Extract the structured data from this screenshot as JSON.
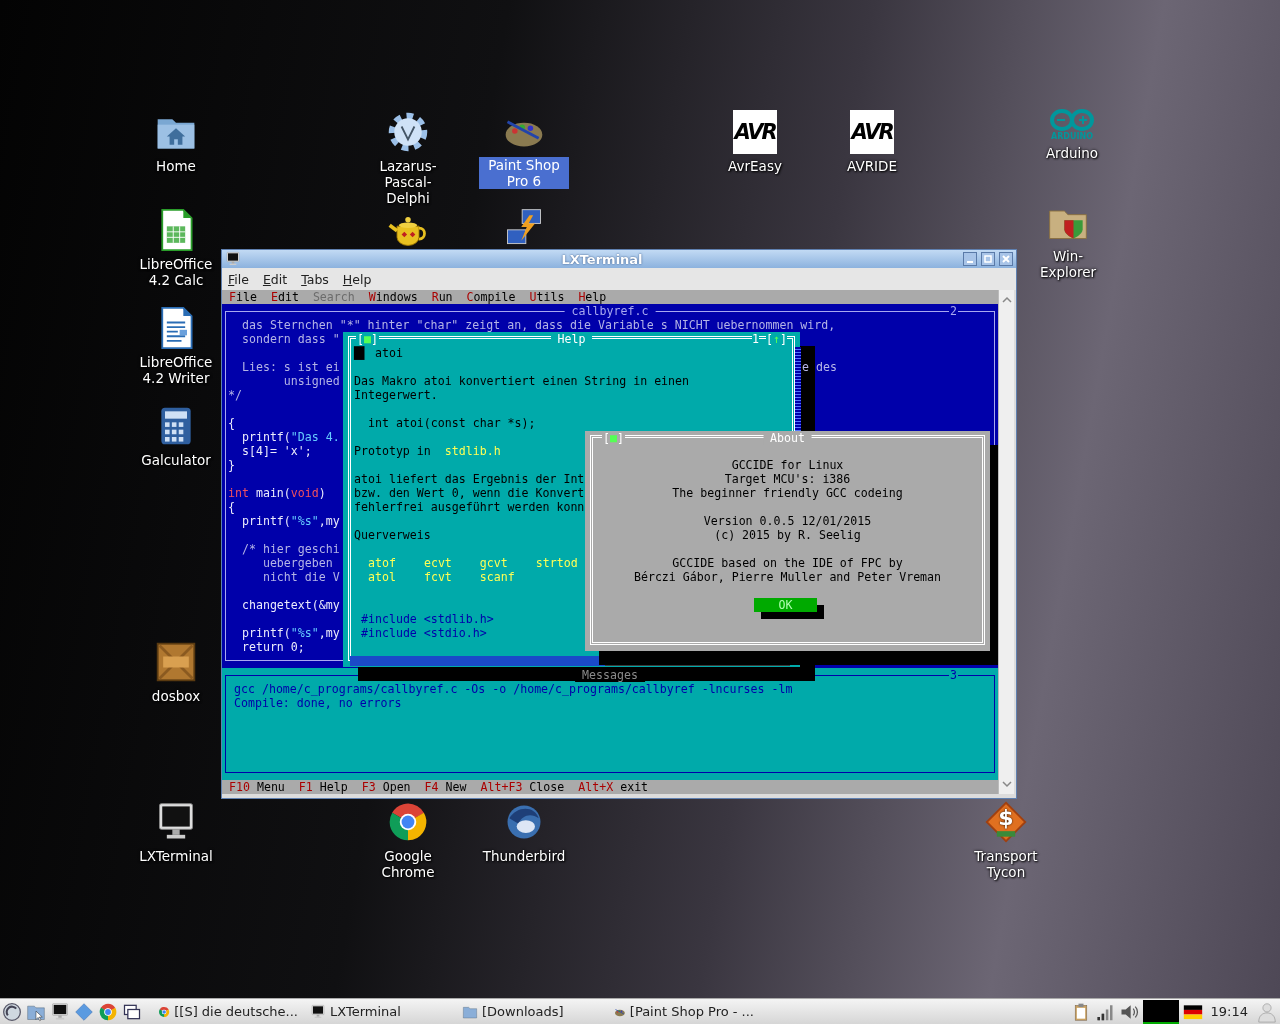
{
  "desktop_icons": [
    {
      "label": "Home",
      "kind": "home",
      "selected": false
    },
    {
      "label": "Lazarus-Pascal-Delphi",
      "kind": "gear",
      "selected": false
    },
    {
      "label": "Paint Shop Pro 6",
      "kind": "palette",
      "selected": true
    },
    {
      "label": "AvrEasy",
      "kind": "avr",
      "logo_text": "AVR",
      "selected": false
    },
    {
      "label": "AVRIDE",
      "kind": "avr",
      "logo_text": "AVR",
      "selected": false
    },
    {
      "label": "Arduino",
      "kind": "arduino",
      "logo_text": "ARDUINO",
      "selected": false
    },
    {
      "label": "LibreOffice 4.2 Calc",
      "kind": "spreadsheet",
      "selected": false
    },
    {
      "kind": "teapot",
      "selected": false
    },
    {
      "kind": "network",
      "selected": false
    },
    {
      "label": "Win-Explorer",
      "kind": "explorer",
      "selected": false
    },
    {
      "label": "LibreOffice 4.2 Writer",
      "kind": "document",
      "selected": false
    },
    {
      "label": "Galculator",
      "kind": "calculator",
      "selected": false
    },
    {
      "label": "dosbox",
      "kind": "dosbox",
      "selected": false
    },
    {
      "label": "LXTerminal",
      "kind": "monitor",
      "selected": false
    },
    {
      "label": "Google Chrome",
      "kind": "chrome",
      "selected": false
    },
    {
      "label": "Thunderbird",
      "kind": "bird",
      "selected": false
    },
    {
      "label": "Transport Tycon",
      "kind": "tycoon",
      "logo_text": "$",
      "selected": false
    }
  ],
  "window": {
    "title": "LXTerminal",
    "menu": [
      "File",
      "Edit",
      "Tabs",
      "Help"
    ],
    "ide": {
      "menu": [
        {
          "label": "File",
          "disabled": false
        },
        {
          "label": "Edit",
          "disabled": false
        },
        {
          "label": "Search",
          "disabled": true
        },
        {
          "label": "Windows",
          "disabled": false
        },
        {
          "label": "Run",
          "disabled": false
        },
        {
          "label": "Compile",
          "disabled": false
        },
        {
          "label": "Utils",
          "disabled": false
        },
        {
          "label": "Help",
          "disabled": false
        }
      ],
      "editor": {
        "title": "callbyref.c",
        "number": "2",
        "lines": [
          {
            "kind": "code",
            "segments": [
              {
                "text": "  das Sternchen \"*\" hinter \"char\" zeigt an, dass die Variable s NICHT uebernommen wird,",
                "kind": "comment"
              }
            ]
          },
          {
            "kind": "code",
            "segments": [
              {
                "text": "  sondern dass \"",
                "kind": "comment"
              }
            ]
          },
          {
            "kind": "blank"
          },
          {
            "kind": "code",
            "segments": [
              {
                "text": "  Lies: s ist ei",
                "kind": "comment"
              }
            ],
            "right": "e des"
          },
          {
            "kind": "code",
            "segments": [
              {
                "text": "        unsigned",
                "kind": "comment"
              }
            ]
          },
          {
            "kind": "code",
            "segments": [
              {
                "text": "*/",
                "kind": "comment"
              }
            ]
          },
          {
            "kind": "blank"
          },
          {
            "kind": "code",
            "segments": [
              {
                "text": "{",
                "kind": "code"
              }
            ]
          },
          {
            "kind": "code",
            "segments": [
              {
                "text": "  printf(",
                "kind": "code"
              },
              {
                "text": "\"Das 4.",
                "kind": "string"
              }
            ]
          },
          {
            "kind": "code",
            "segments": [
              {
                "text": "  s[4]= 'x';",
                "kind": "code"
              }
            ]
          },
          {
            "kind": "code",
            "segments": [
              {
                "text": "}",
                "kind": "code"
              }
            ]
          },
          {
            "kind": "blank"
          },
          {
            "kind": "code",
            "segments": [
              {
                "text": "int",
                "kind": "keyword"
              },
              {
                "text": " main(",
                "kind": "code"
              },
              {
                "text": "void",
                "kind": "keyword"
              },
              {
                "text": ")",
                "kind": "code"
              }
            ]
          },
          {
            "kind": "code",
            "segments": [
              {
                "text": "{",
                "kind": "code"
              }
            ]
          },
          {
            "kind": "code",
            "segments": [
              {
                "text": "  printf(",
                "kind": "code"
              },
              {
                "text": "\"%s\"",
                "kind": "string"
              },
              {
                "text": ",my",
                "kind": "code"
              }
            ]
          },
          {
            "kind": "blank"
          },
          {
            "kind": "code",
            "segments": [
              {
                "text": "  /* hier geschi",
                "kind": "comment"
              }
            ]
          },
          {
            "kind": "code",
            "segments": [
              {
                "text": "     uebergeben",
                "kind": "comment"
              }
            ]
          },
          {
            "kind": "code",
            "segments": [
              {
                "text": "     nicht die V",
                "kind": "comment"
              }
            ]
          },
          {
            "kind": "blank"
          },
          {
            "kind": "code",
            "segments": [
              {
                "text": "  changetext(&my",
                "kind": "code"
              }
            ]
          },
          {
            "kind": "blank"
          },
          {
            "kind": "code",
            "segments": [
              {
                "text": "  printf(",
                "kind": "code"
              },
              {
                "text": "\"%s\"",
                "kind": "string"
              },
              {
                "text": ",my",
                "kind": "code"
              }
            ]
          },
          {
            "kind": "code",
            "segments": [
              {
                "text": "  return 0;",
                "kind": "code"
              }
            ]
          }
        ]
      },
      "messages": {
        "title": "Messages",
        "number": "3",
        "lines": [
          "gcc /home/c_programs/callbyref.c -Os -o /home/c_programs/callbyref -lncurses -lm",
          "Compile: done, no errors"
        ]
      },
      "status_bar": [
        {
          "key": "F10",
          "label": "Menu"
        },
        {
          "key": "F1",
          "label": "Help"
        },
        {
          "key": "F3",
          "label": "Open"
        },
        {
          "key": "F4",
          "label": "New"
        },
        {
          "key": "Alt+F3",
          "label": "Close"
        },
        {
          "key": "Alt+X",
          "label": "exit"
        }
      ],
      "help": {
        "title": "Help",
        "close_box": "[■]",
        "number": "1",
        "zoom_box": "[↑]",
        "lines": [
          {
            "kind": "heading",
            "text": "█▌ atoi"
          },
          {
            "kind": "blank"
          },
          {
            "kind": "text",
            "text": "Das Makro atoi konvertiert einen String in einen"
          },
          {
            "kind": "text",
            "text": "Integerwert."
          },
          {
            "kind": "blank"
          },
          {
            "kind": "code",
            "text": "int atoi(const char *s);"
          },
          {
            "kind": "blank"
          },
          {
            "kind": "proto",
            "text": "Prototyp in",
            "link": "stdlib.h"
          },
          {
            "kind": "blank"
          },
          {
            "kind": "text",
            "text": "atoi liefert das Ergebnis der Int"
          },
          {
            "kind": "text",
            "text": "bzw. den Wert 0, wenn die Konvert"
          },
          {
            "kind": "text",
            "text": "fehlerfrei ausgeführt werden konn"
          },
          {
            "kind": "blank"
          },
          {
            "kind": "text",
            "text": "Querverweis"
          },
          {
            "kind": "blank"
          },
          {
            "kind": "links",
            "links": [
              "atof",
              "ecvt",
              "gcvt",
              "strtod"
            ]
          },
          {
            "kind": "links",
            "links": [
              "atol",
              "fcvt",
              "scanf"
            ]
          },
          {
            "kind": "blank"
          },
          {
            "kind": "blank"
          },
          {
            "kind": "include",
            "text": "#include <stdlib.h>"
          },
          {
            "kind": "include",
            "text": "#include <stdio.h>"
          }
        ]
      },
      "about": {
        "title": "About",
        "close_box": "[■]",
        "paragraphs": [
          [
            "GCCIDE for Linux",
            "Target MCU's: i386",
            "The beginner friendly GCC codeing"
          ],
          [
            "Version 0.0.5 12/01/2015",
            "(c) 2015 by R. Seelig"
          ],
          [
            "GCCIDE based on the IDE of FPC by",
            "Bérczi Gábor, Pierre Muller and Peter Vreman"
          ]
        ],
        "button": "OK"
      }
    }
  },
  "taskbar": {
    "launchers": [
      {
        "kind": "start"
      },
      {
        "kind": "files"
      },
      {
        "kind": "monitor"
      },
      {
        "kind": "cube"
      },
      {
        "kind": "chrome"
      },
      {
        "kind": "windows"
      }
    ],
    "tasks": [
      {
        "label": "[[S] die deutsche...",
        "kind": "chrome"
      },
      {
        "label": "LXTerminal",
        "kind": "monitor"
      },
      {
        "label": "[Downloads]",
        "kind": "folder"
      },
      {
        "label": "[Paint Shop Pro - ...",
        "kind": "palette"
      }
    ],
    "tray": [
      {
        "kind": "clipboard"
      },
      {
        "kind": "signal"
      },
      {
        "kind": "volume"
      },
      {
        "kind": "cpu"
      },
      {
        "kind": "flag"
      }
    ],
    "clock": "19:14",
    "user": {
      "kind": "user"
    }
  }
}
